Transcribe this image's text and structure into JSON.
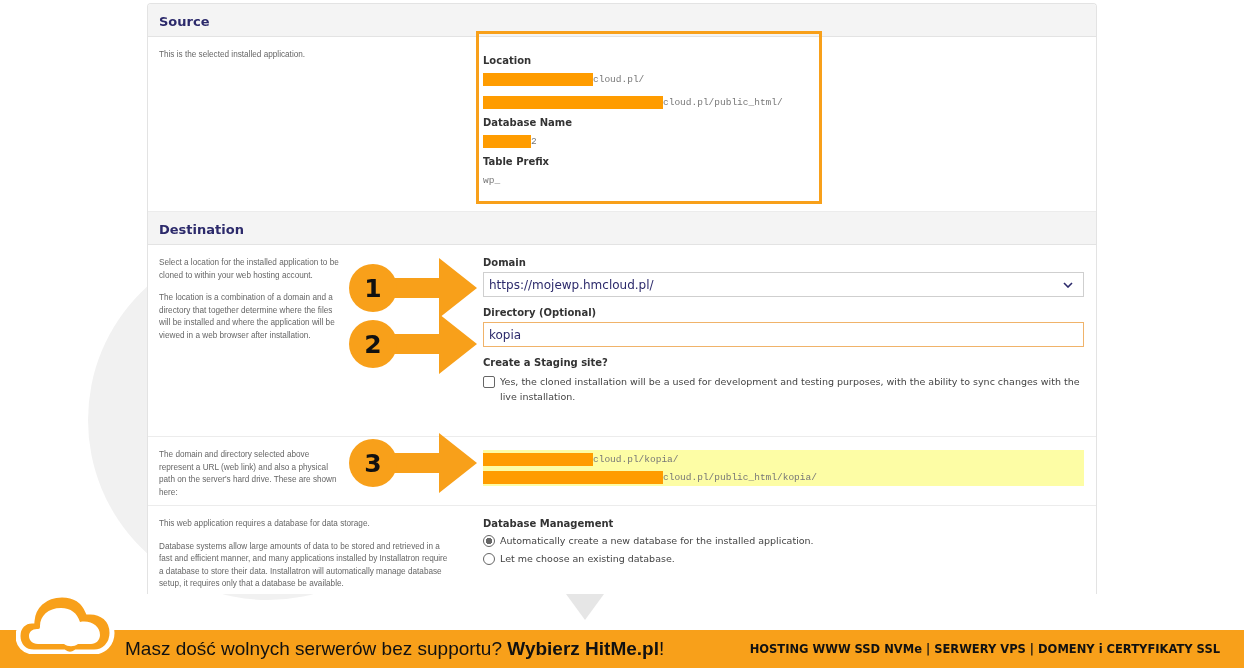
{
  "source": {
    "title": "Source",
    "description": "This is the selected installed application.",
    "fields": [
      {
        "label": "Location",
        "values": [
          {
            "text": "cloud.pl/",
            "redacted": true
          },
          {
            "text": "cloud.pl/public_html/",
            "redacted": true
          }
        ]
      },
      {
        "label": "Database Name",
        "values": [
          {
            "text": "2",
            "redacted": true
          }
        ]
      },
      {
        "label": "Table Prefix",
        "values": [
          {
            "text": "wp_",
            "redacted": false
          }
        ]
      }
    ]
  },
  "destination": {
    "title": "Destination",
    "paragraphs": [
      "Select a location for the installed application to be cloned to within your web hosting account.",
      "The location is a combination of a domain and a directory that together determine where the files will be installed and where the application will be viewed in a web browser after installation."
    ],
    "domain": {
      "label": "Domain",
      "value": "https://mojewp.hmcloud.pl/"
    },
    "directory": {
      "label": "Directory (Optional)",
      "value": "kopia"
    },
    "staging": {
      "label": "Create a Staging site?",
      "option": "Yes, the cloned installation will be a used for development and testing purposes, with the ability to sync changes with the live installation.",
      "checked": false
    },
    "paths_description": "The domain and directory selected above represent a URL (web link) and also a physical path on the server's hard drive. These are shown here:",
    "paths": [
      {
        "text": "cloud.pl/kopia/",
        "redacted": true
      },
      {
        "text": "cloud.pl/public_html/kopia/",
        "redacted": true
      }
    ]
  },
  "database": {
    "paragraphs": [
      "This web application requires a database for data storage.",
      "Database systems allow large amounts of data to be stored and retrieved in a fast and efficient manner, and many applications installed by Installatron require a database to store their data. Installatron will automatically manage database setup, it requires only that a database be available."
    ],
    "label": "Database Management",
    "options": [
      {
        "label": "Automatically create a new database for the installed application.",
        "selected": true
      },
      {
        "label": "Let me choose an existing database.",
        "selected": false
      }
    ]
  },
  "callouts": [
    "1",
    "2",
    "3"
  ],
  "banner": {
    "tagline": "Masz dość wolnych serwerów bez supportu? **Wybierz HitMe.pl**!",
    "services": "HOSTING WWW SSD NVMe | SERWERY VPS | DOMENY i CERTYFIKATY SSL"
  }
}
